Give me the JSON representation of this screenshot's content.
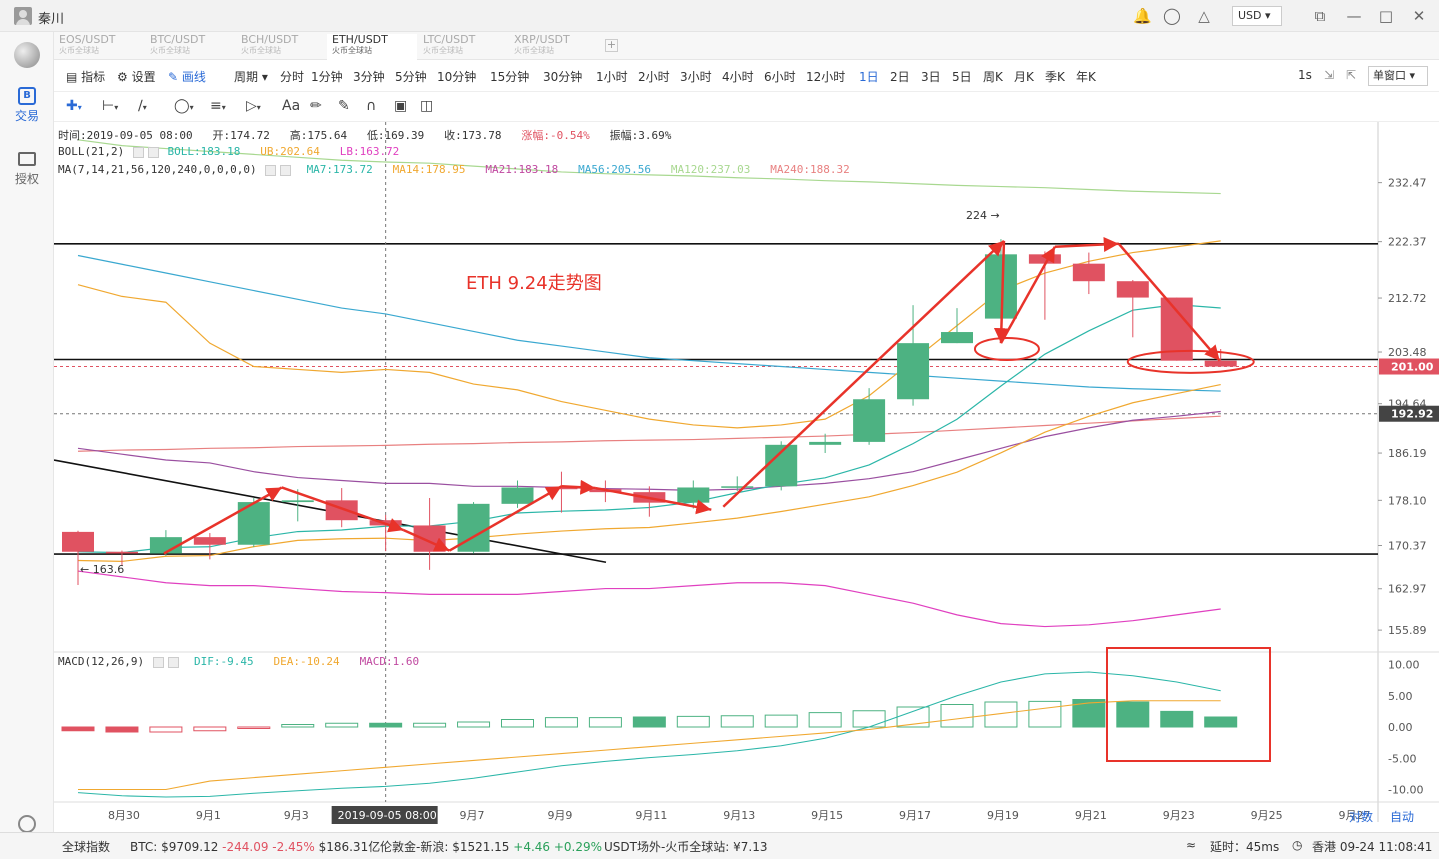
{
  "window": {
    "user_name": "秦川",
    "currency": "USD"
  },
  "sidebar": {
    "items": [
      {
        "label": "交易"
      },
      {
        "label": "授权"
      }
    ]
  },
  "tabs": [
    {
      "pair": "EOS/USDT",
      "exchange": "火币全球站"
    },
    {
      "pair": "BTC/USDT",
      "exchange": "火币全球站"
    },
    {
      "pair": "BCH/USDT",
      "exchange": "火币全球站"
    },
    {
      "pair": "ETH/USDT",
      "exchange": "火币全球站"
    },
    {
      "pair": "LTC/USDT",
      "exchange": "火币全球站"
    },
    {
      "pair": "XRP/USDT",
      "exchange": "火币全球站"
    }
  ],
  "toolbar": {
    "indicator": "指标",
    "settings": "设置",
    "draw": "画线",
    "period": "周期",
    "periods": [
      "分时",
      "1分钟",
      "3分钟",
      "5分钟",
      "10分钟",
      "15分钟",
      "30分钟",
      "1小时",
      "2小时",
      "3小时",
      "4小时",
      "6小时",
      "12小时",
      "1日",
      "2日",
      "3日",
      "5日",
      "周K",
      "月K",
      "季K",
      "年K"
    ],
    "selected_period": "1日",
    "interval": "1s",
    "window_mode": "单窗口",
    "font_tool": "Aa"
  },
  "info": {
    "time": "时间:2019-09-05 08:00",
    "open": "开:174.72",
    "high": "高:175.64",
    "low": "低:169.39",
    "close": "收:173.78",
    "change": "涨幅:-0.54%",
    "amplitude": "振幅:3.69%"
  },
  "indicators": {
    "boll": {
      "name": "BOLL(21,2)",
      "boll": "BOLL:183.18",
      "ub": "UB:202.64",
      "lb": "LB:163.72"
    },
    "ma": {
      "name": "MA(7,14,21,56,120,240,0,0,0,0)",
      "ma7": "MA7:173.72",
      "ma14": "MA14:178.95",
      "ma21": "MA21:183.18",
      "ma56": "MA56:205.56",
      "ma120": "MA120:237.03",
      "ma240": "MA240:188.32"
    },
    "macd": {
      "name": "MACD(12,26,9)",
      "dif": "DIF:-9.45",
      "dea": "DEA:-10.24",
      "macd": "MACD:1.60"
    }
  },
  "annotations": {
    "title": "ETH 9.24走势图",
    "high_label": "224",
    "low_label": "163.6"
  },
  "axis": {
    "price_ticks": [
      "232.47",
      "222.37",
      "212.72",
      "203.48",
      "194.64",
      "186.19",
      "178.10",
      "170.37",
      "162.97",
      "155.89"
    ],
    "current_price": "201.00",
    "cursor_price": "192.92",
    "macd_ticks": [
      "10.00",
      "5.00",
      "0.00",
      "-5.00",
      "-10.00"
    ],
    "date_ticks": [
      "8月30",
      "9月1",
      "9月3",
      "9月5",
      "9月7",
      "9月9",
      "9月11",
      "9月13",
      "9月15",
      "9月17",
      "9月19",
      "9月21",
      "9月23",
      "9月25",
      "9月27"
    ],
    "cursor_date": "2019-09-05 08:00:00",
    "log_label": "对数",
    "auto_label": "自动"
  },
  "colors": {
    "up": "#4db282",
    "down": "#e05261",
    "arrow": "#e8332a",
    "accent": "#2a6ad6"
  },
  "chart_data": {
    "type": "candlestick",
    "dates": [
      "8/29",
      "8/30",
      "8/31",
      "9/1",
      "9/2",
      "9/3",
      "9/4",
      "9/5",
      "9/6",
      "9/7",
      "9/8",
      "9/9",
      "9/10",
      "9/11",
      "9/12",
      "9/13",
      "9/14",
      "9/15",
      "9/16",
      "9/17",
      "9/18",
      "9/19",
      "9/20",
      "9/21",
      "9/22",
      "9/23",
      "9/24"
    ],
    "open": [
      172.7,
      169.3,
      169.0,
      171.8,
      170.5,
      177.8,
      178.1,
      174.7,
      173.8,
      169.3,
      177.5,
      180.3,
      180.0,
      179.5,
      177.7,
      180.3,
      180.5,
      187.6,
      188.1,
      195.4,
      205.0,
      209.2,
      220.2,
      218.6,
      215.6,
      212.8,
      202.0
    ],
    "high": [
      172.9,
      169.5,
      173.0,
      172.5,
      178.5,
      180.0,
      180.2,
      175.6,
      178.5,
      177.8,
      181.5,
      183.0,
      181.5,
      180.5,
      181.5,
      182.2,
      188.2,
      189.5,
      197.3,
      211.5,
      211.0,
      222.8,
      220.7,
      220.5,
      215.8,
      212.8,
      204.0
    ],
    "low": [
      163.6,
      167.0,
      168.6,
      168.0,
      170.1,
      174.5,
      173.5,
      169.4,
      166.2,
      169.0,
      176.8,
      176.0,
      177.8,
      175.3,
      176.7,
      179.7,
      179.8,
      186.2,
      187.6,
      194.3,
      205.0,
      209.0,
      209.0,
      213.4,
      206.0,
      202.0,
      201.5
    ],
    "close": [
      169.3,
      169.0,
      171.8,
      170.5,
      177.8,
      178.1,
      174.7,
      173.8,
      169.3,
      177.5,
      180.3,
      180.0,
      179.5,
      177.7,
      180.3,
      180.5,
      187.6,
      188.1,
      195.4,
      205.0,
      206.9,
      220.2,
      218.6,
      215.6,
      212.8,
      202.0,
      201.0
    ],
    "macd": [
      -0.6,
      -0.8,
      -0.8,
      -0.6,
      -0.06,
      0.4,
      0.6,
      0.6,
      0.6,
      0.8,
      1.2,
      1.5,
      1.5,
      1.6,
      1.7,
      1.8,
      1.9,
      2.3,
      2.6,
      3.2,
      3.6,
      4.0,
      4.1,
      4.4,
      4.0,
      2.5,
      1.6
    ],
    "ylim": [
      153,
      236
    ],
    "macd_ylim": [
      -12,
      12
    ]
  }
}
